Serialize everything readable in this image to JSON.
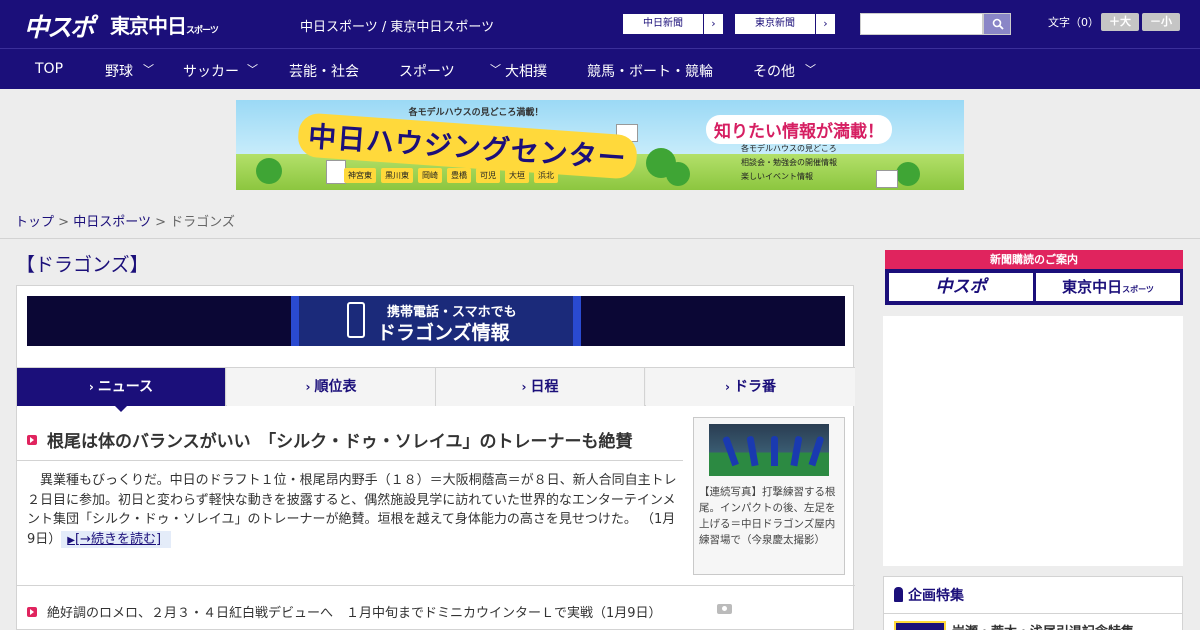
{
  "header": {
    "logo_main": "中スポ",
    "logo_tokyo": "東京中日",
    "logo_tokyo_sub": "スポーツ",
    "site_title": "中日スポーツ / 東京中日スポーツ",
    "paper_links": [
      {
        "label": "中日新聞"
      },
      {
        "label": "東京新聞"
      }
    ],
    "search": {
      "placeholder": "",
      "icon": "search-icon"
    },
    "font_size_label": "文字（0）",
    "font_larger": "＋大",
    "font_smaller": "－小"
  },
  "nav": {
    "items": [
      {
        "label": "TOP",
        "has_menu": false
      },
      {
        "label": "野球",
        "has_menu": true
      },
      {
        "label": "サッカー",
        "has_menu": true
      },
      {
        "label": "芸能・社会",
        "has_menu": false
      },
      {
        "label": "スポーツ",
        "has_menu": true
      },
      {
        "label": "大相撲",
        "has_menu": false
      },
      {
        "label": "競馬・ボート・競輪",
        "has_menu": false
      },
      {
        "label": "その他",
        "has_menu": true
      }
    ]
  },
  "ad_banner": {
    "top_text": "各モデルハウスの見どころ満載！",
    "main_text": "中日ハウジングセンター",
    "right_text": "知りたい情報が満載！",
    "bullets": [
      "各モデルハウスの見どころ",
      "相談会・勉強会の開催情報",
      "楽しいイベント情報"
    ],
    "cities": [
      "神宮東",
      "黒川東",
      "岡崎",
      "豊橋",
      "可児",
      "大垣",
      "浜北"
    ]
  },
  "breadcrumb": {
    "items": [
      {
        "label": "トップ",
        "link": true
      },
      {
        "label": "中日スポーツ",
        "link": true
      },
      {
        "label": "ドラゴンズ",
        "link": false
      }
    ],
    "separator": ">"
  },
  "main": {
    "section_title": "【ドラゴンズ】",
    "mobile_banner": {
      "line1": "携帯電話・スマホでも",
      "line2": "ドラゴンズ情報"
    },
    "tabs": [
      {
        "label": "ニュース",
        "active": true
      },
      {
        "label": "順位表",
        "active": false
      },
      {
        "label": "日程",
        "active": false
      },
      {
        "label": "ドラ番",
        "active": false
      }
    ],
    "top_article": {
      "headline": "根尾は体のバランスがいい　「シルク・ドゥ・ソレイユ」のトレーナーも絶賛",
      "lead": "異業種もびっくりだ。中日のドラフト１位・根尾昂内野手（１８）＝大阪桐蔭高＝が８日、新人合同自主トレ２日目に参加。初日と変わらず軽快な動きを披露すると、偶然施設見学に訪れていた世界的なエンターテインメント集団「シルク・ドゥ・ソレイユ」のトレーナーが絶賛。垣根を越えて身体能力の高さを見せつけた。",
      "date": "（1月9日）",
      "read_more": "[→続きを読む]",
      "photo_caption": "【連続写真】打撃練習する根尾。インパクトの後、左足を上げる＝中日ドラゴンズ屋内練習場で（今泉慶太撮影）"
    },
    "articles": [
      {
        "text": "絶好調のロメロ、２月３・４日紅白戦デビューへ　１月中旬までドミニカウインターＬで実戦（1月9日）",
        "has_photo": true
      }
    ]
  },
  "sidebar": {
    "subscribe": {
      "heading": "新聞購読のご案内",
      "buttons": [
        {
          "label": "中スポ"
        },
        {
          "label": "東京中日"
        }
      ],
      "tokyo_sub": "スポーツ"
    },
    "feature": {
      "heading": "企画特集",
      "item": "岩瀬・荒木・浅尾引退記念特集"
    }
  },
  "colors": {
    "brand": "#1b0f7a",
    "accent": "#e0245e",
    "background": "#ededed"
  }
}
